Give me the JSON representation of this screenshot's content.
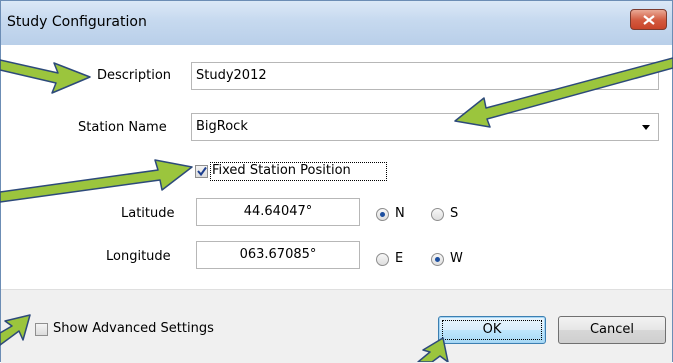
{
  "window": {
    "title": "Study Configuration"
  },
  "fields": {
    "description_label": "Description",
    "description_value": "Study2012",
    "station_name_label": "Station Name",
    "station_name_value": "BigRock",
    "fixed_position_label": "Fixed Station Position",
    "fixed_position_checked": true,
    "latitude_label": "Latitude",
    "latitude_value": "44.64047°",
    "longitude_label": "Longitude",
    "longitude_value": "063.67085°",
    "lat_n": "N",
    "lat_s": "S",
    "lat_selected": "N",
    "lon_e": "E",
    "lon_w": "W",
    "lon_selected": "W"
  },
  "footer": {
    "show_advanced_label": "Show Advanced Settings",
    "ok_label": "OK",
    "cancel_label": "Cancel"
  },
  "colors": {
    "arrow": "#9bc53d",
    "arrow_outline": "#2d4a7a"
  },
  "icons": [
    "close-icon",
    "checkmark-icon",
    "chevron-down-icon"
  ]
}
